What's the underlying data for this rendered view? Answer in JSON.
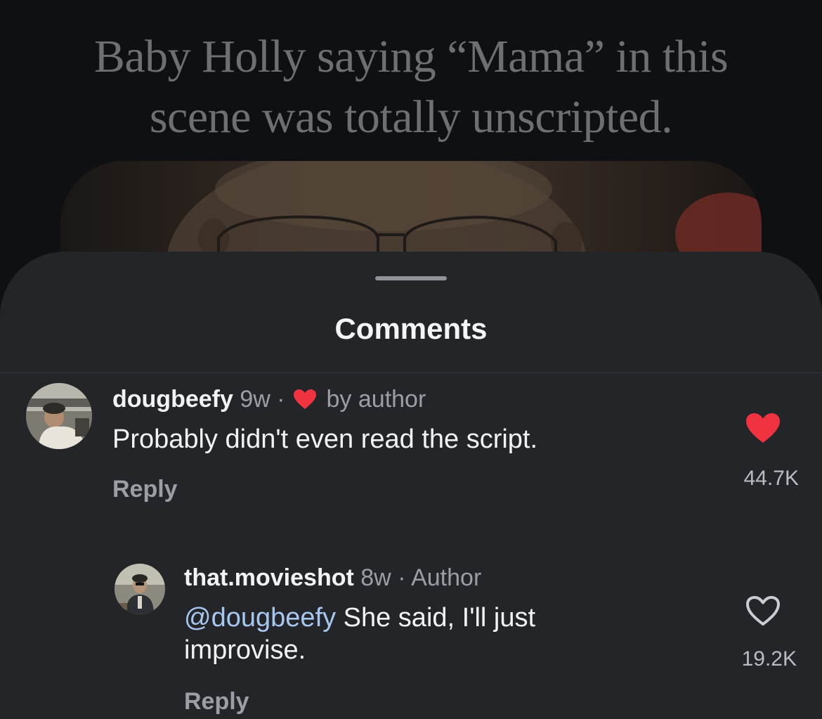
{
  "post": {
    "caption_line1": "Baby Holly saying “Mama” in this",
    "caption_line2": "scene was totally unscripted."
  },
  "sheet": {
    "title": "Comments"
  },
  "comments": [
    {
      "username": "dougbeefy",
      "age": "9w",
      "separator": "·",
      "badge": "by author",
      "badge_icon": "heart-icon",
      "text": "Probably didn't even read the script.",
      "reply_label": "Reply",
      "liked": true,
      "likes": "44.7K"
    },
    {
      "username": "that.movieshot",
      "age": "8w",
      "separator": "·",
      "badge": "Author",
      "mention": "@dougbeefy",
      "text_after_mention": " She said, I'll just",
      "text_line2": "improvise.",
      "reply_label": "Reply",
      "liked": false,
      "likes": "19.2K"
    }
  ],
  "colors": {
    "sheet_bg": "#232529",
    "like_red": "#ef3340",
    "mention_blue": "#a7c6f0"
  }
}
